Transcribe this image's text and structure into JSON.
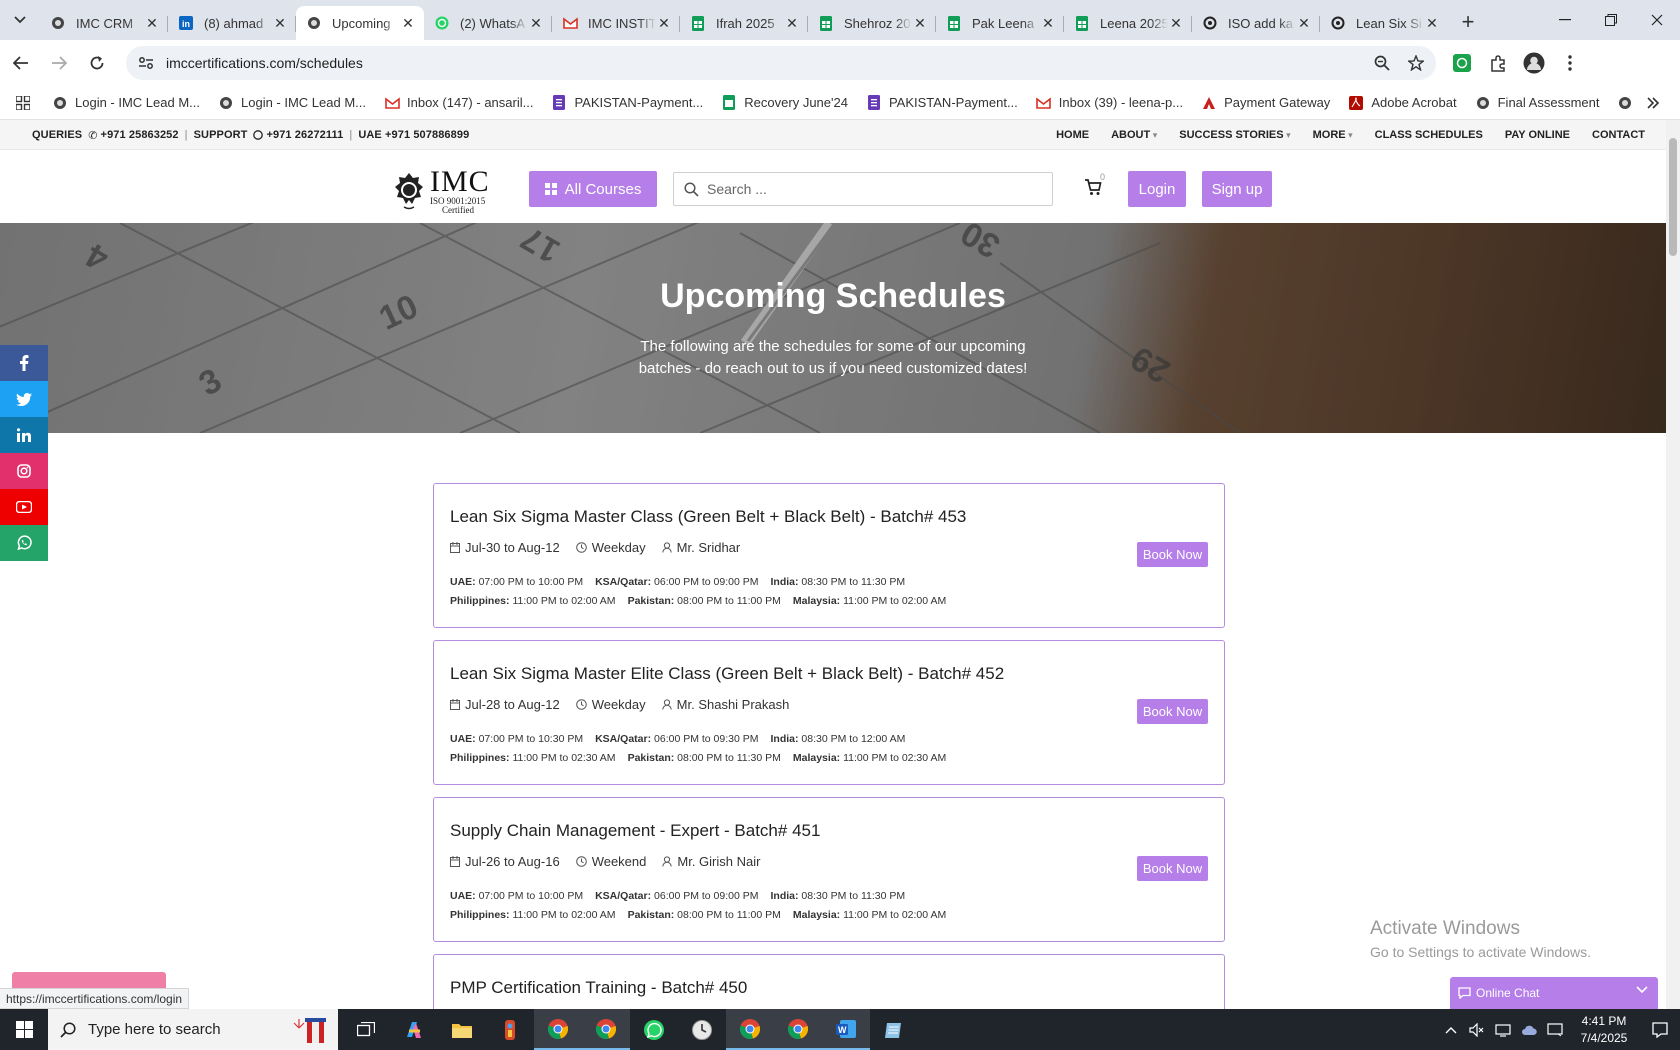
{
  "browser": {
    "tabs": [
      {
        "title": "IMC CRM",
        "active": false
      },
      {
        "title": "(8) ahmad",
        "active": false
      },
      {
        "title": "Upcoming",
        "active": true
      },
      {
        "title": "(2) WhatsA",
        "active": false
      },
      {
        "title": "IMC INSTIT",
        "active": false
      },
      {
        "title": "Ifrah 2025",
        "active": false
      },
      {
        "title": "Shehroz 20",
        "active": false
      },
      {
        "title": "Pak Leena",
        "active": false
      },
      {
        "title": "Leena 2025",
        "active": false
      },
      {
        "title": "ISO add ka",
        "active": false
      },
      {
        "title": "Lean Six Si",
        "active": false
      }
    ],
    "url": "imccertifications.com/schedules",
    "bookmarks": [
      {
        "label": "Login - IMC Lead M...",
        "icon": "imc-icon"
      },
      {
        "label": "Login - IMC Lead M...",
        "icon": "imc-icon"
      },
      {
        "label": "Inbox (147) - ansaril...",
        "icon": "gmail-icon"
      },
      {
        "label": "PAKISTAN-Payment...",
        "icon": "forms-icon"
      },
      {
        "label": "Recovery June'24",
        "icon": "sheets-icon"
      },
      {
        "label": "PAKISTAN-Payment...",
        "icon": "forms-icon"
      },
      {
        "label": "Inbox (39) - leena-p...",
        "icon": "gmail-icon"
      },
      {
        "label": "Payment Gateway",
        "icon": "arrow-icon"
      },
      {
        "label": "Adobe Acrobat",
        "icon": "acrobat-icon"
      },
      {
        "label": "Final Assessment",
        "icon": "imc-icon"
      }
    ]
  },
  "site": {
    "topbar": {
      "queries": "QUERIES",
      "queries_phone": "+971 25863252",
      "support": "SUPPORT",
      "support_phone": "+971 26272111",
      "uae": "UAE +971 507886899"
    },
    "nav": [
      "HOME",
      "ABOUT",
      "SUCCESS STORIES",
      "MORE",
      "CLASS SCHEDULES",
      "PAY ONLINE",
      "CONTACT"
    ],
    "logo": {
      "name": "IMC",
      "cert_line1": "ISO 9001:2015",
      "cert_line2": "Certified"
    },
    "all_courses": "All Courses",
    "search_placeholder": "Search ...",
    "cart_count": "0",
    "login": "Login",
    "signup": "Sign up",
    "hero": {
      "title": "Upcoming Schedules",
      "subtitle": "The following are the schedules for some of our upcoming batches - do reach out to us if you need customized dates!"
    },
    "book_label": "Book Now",
    "schedules": [
      {
        "title": "Lean Six Sigma Master Class (Green Belt + Black Belt) - Batch# 453",
        "dates": "Jul-30 to Aug-12",
        "type": "Weekday",
        "trainer": "Mr. Sridhar",
        "row1": [
          {
            "region": "UAE:",
            "time": "07:00 PM to 10:00 PM"
          },
          {
            "region": "KSA/Qatar:",
            "time": "06:00 PM to 09:00 PM"
          },
          {
            "region": "India:",
            "time": "08:30 PM to 11:30 PM"
          }
        ],
        "row2": [
          {
            "region": "Philippines:",
            "time": "11:00 PM to 02:00 AM"
          },
          {
            "region": "Pakistan:",
            "time": "08:00 PM to 11:00 PM"
          },
          {
            "region": "Malaysia:",
            "time": "11:00 PM to 02:00 AM"
          }
        ]
      },
      {
        "title": "Lean Six Sigma Master Elite Class (Green Belt + Black Belt) - Batch# 452",
        "dates": "Jul-28 to Aug-12",
        "type": "Weekday",
        "trainer": "Mr. Shashi Prakash",
        "row1": [
          {
            "region": "UAE:",
            "time": "07:00 PM to 10:30 PM"
          },
          {
            "region": "KSA/Qatar:",
            "time": "06:00 PM to 09:30 PM"
          },
          {
            "region": "India:",
            "time": "08:30 PM to 12:00 AM"
          }
        ],
        "row2": [
          {
            "region": "Philippines:",
            "time": "11:00 PM to 02:30 AM"
          },
          {
            "region": "Pakistan:",
            "time": "08:00 PM to 11:30 PM"
          },
          {
            "region": "Malaysia:",
            "time": "11:00 PM to 02:30 AM"
          }
        ]
      },
      {
        "title": "Supply Chain Management - Expert - Batch# 451",
        "dates": "Jul-26 to Aug-16",
        "type": "Weekend",
        "trainer": "Mr. Girish Nair",
        "row1": [
          {
            "region": "UAE:",
            "time": "07:00 PM to 10:00 PM"
          },
          {
            "region": "KSA/Qatar:",
            "time": "06:00 PM to 09:00 PM"
          },
          {
            "region": "India:",
            "time": "08:30 PM to 11:30 PM"
          }
        ],
        "row2": [
          {
            "region": "Philippines:",
            "time": "11:00 PM to 02:00 AM"
          },
          {
            "region": "Pakistan:",
            "time": "08:00 PM to 11:00 PM"
          },
          {
            "region": "Malaysia:",
            "time": "11:00 PM to 02:00 AM"
          }
        ]
      },
      {
        "title": "PMP Certification Training - Batch# 450"
      }
    ],
    "online_chat": "Online Chat",
    "status_url": "https://imccertifications.com/login"
  },
  "watermark": {
    "line1": "Activate Windows",
    "line2": "Go to Settings to activate Windows."
  },
  "taskbar": {
    "search_placeholder": "Type here to search",
    "time": "4:41 PM",
    "date": "7/4/2025"
  },
  "colors": {
    "accent": "#b57ee8",
    "card_border": "#b58de0",
    "taskbar": "#20242b"
  }
}
